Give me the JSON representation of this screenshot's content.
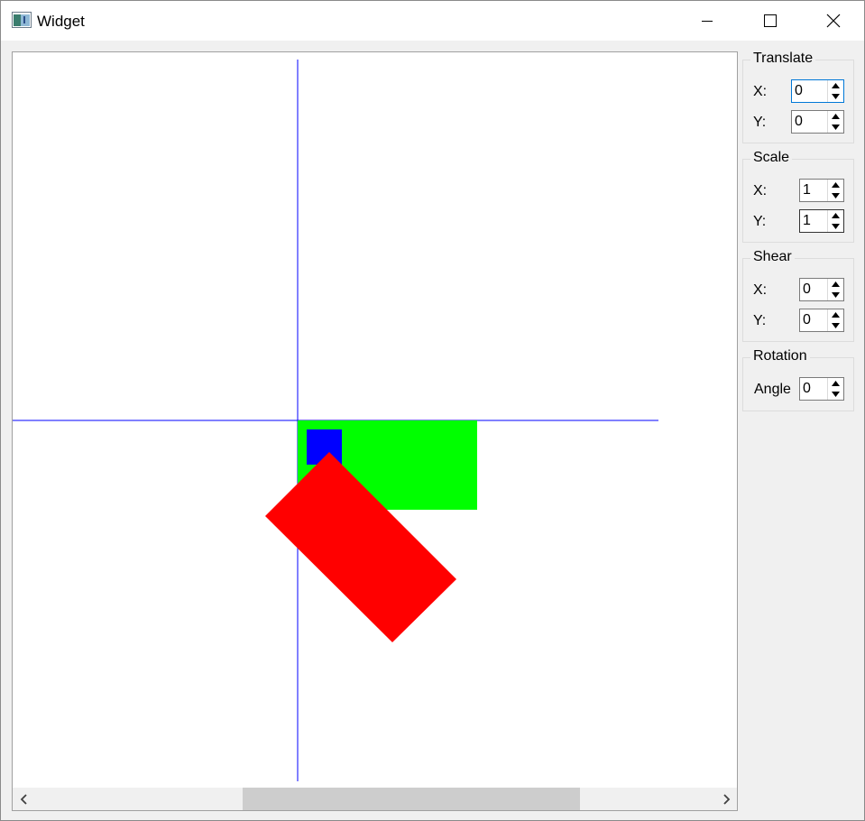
{
  "window": {
    "title": "Widget"
  },
  "panel": {
    "translate": {
      "title": "Translate",
      "x_label": "X:",
      "x_value": "0",
      "y_label": "Y:",
      "y_value": "0"
    },
    "scale": {
      "title": "Scale",
      "x_label": "X:",
      "x_value": "1",
      "y_label": "Y:",
      "y_value": "1"
    },
    "shear": {
      "title": "Shear",
      "x_label": "X:",
      "x_value": "0",
      "y_label": "Y:",
      "y_value": "0"
    },
    "rotation": {
      "title": "Rotation",
      "angle_label": "Angle",
      "angle_value": "0"
    }
  },
  "scene": {
    "axis_color": "#0000ff",
    "rectangles": [
      {
        "name": "green-rect",
        "color": "#00ff00"
      },
      {
        "name": "blue-square",
        "color": "#0000ff"
      },
      {
        "name": "red-rotated-rect",
        "color": "#ff0000",
        "rotation_deg": 45
      }
    ]
  },
  "colors": {
    "window_bg": "#f0f0f0",
    "focus_border": "#0078d7"
  }
}
